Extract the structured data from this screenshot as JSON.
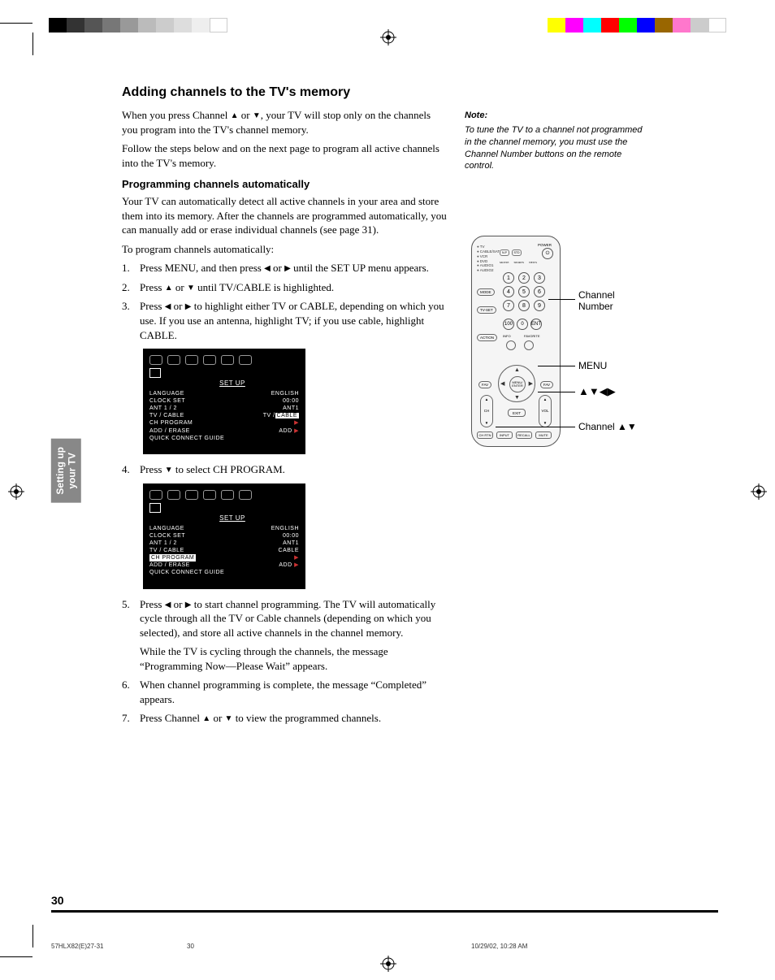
{
  "colorBar": [
    "#000",
    "#333",
    "#555",
    "#777",
    "#999",
    "#bbb",
    "#ccc",
    "#ddd",
    "#eee",
    "#fff"
  ],
  "colorBarR": [
    "#ff0",
    "#f0f",
    "#0ff",
    "#f00",
    "#0f0",
    "#00f",
    "#960",
    "#f7c",
    "#ccc",
    "#fff"
  ],
  "title": "Adding channels to the TV's memory",
  "intro1_a": "When you press Channel ",
  "intro1_b": " or ",
  "intro1_c": ", your TV will stop only on the channels you program into the TV's channel memory.",
  "intro2": "Follow the steps below and on the next page to program all active channels into the TV's memory.",
  "subhead": "Programming channels automatically",
  "para1": "Your TV can automatically detect all active channels in your area and store them into its memory. After the channels are programmed automatically, you can manually add or erase individual channels (see page 31).",
  "para2": "To program channels automatically:",
  "step1_a": "Press MENU, and then press ",
  "step1_b": " or ",
  "step1_c": " until the SET UP menu appears.",
  "step2_a": "Press ",
  "step2_b": " or ",
  "step2_c": " until TV/CABLE is highlighted.",
  "step3_a": "Press ",
  "step3_b": " or ",
  "step3_c": " to highlight either TV or CABLE, depending on which you use. If you use an antenna, highlight TV; if you use cable, highlight CABLE.",
  "step4_a": "Press ",
  "step4_b": " to select CH PROGRAM.",
  "step5_a": "Press ",
  "step5_b": " or ",
  "step5_c": " to start channel programming. The TV will automatically cycle through all the TV or Cable channels (depending on which you selected), and store all active channels in the channel memory.",
  "step5_note": "While the TV is cycling through the channels, the message “Programming Now—Please Wait” appears.",
  "step6": "When channel programming is complete, the message “Completed” appears.",
  "step7_a": "Press Channel ",
  "step7_b": " or ",
  "step7_c": " to view the programmed channels.",
  "osd": {
    "title": "SET  UP",
    "rows1": [
      {
        "l": "LANGUAGE",
        "r": "ENGLISH"
      },
      {
        "l": "CLOCK  SET",
        "r": "00:00"
      },
      {
        "l": "ANT 1 / 2",
        "r": "ANT1"
      }
    ],
    "tvcable_l": "TV / CABLE",
    "tvcable_tv": "TV /",
    "tvcable_hl": "CABLE",
    "rows1b": [
      {
        "l": "CH  PROGRAM",
        "r": ""
      },
      {
        "l": "ADD / ERASE",
        "r": "ADD"
      },
      {
        "l": "QUICK CONNECT GUIDE",
        "r": ""
      }
    ],
    "rows2": [
      {
        "l": "LANGUAGE",
        "r": "ENGLISH"
      },
      {
        "l": "CLOCK  SET",
        "r": "00:00"
      },
      {
        "l": "ANT 1 / 2",
        "r": "ANT1"
      },
      {
        "l": "TV / CABLE",
        "r": "CABLE"
      }
    ],
    "chprog_l": "CH  PROGRAM",
    "rows2b": [
      {
        "l": "ADD / ERASE",
        "r": "ADD"
      },
      {
        "l": "QUICK CONNECT GUIDE",
        "r": ""
      }
    ]
  },
  "note_head": "Note:",
  "note_body": "To tune the TV to a channel not programmed in the channel memory, you must use the Channel Number buttons on the remote control.",
  "remote": {
    "devices": [
      "TV",
      "CABLE/SAT",
      "VCR",
      "DVD",
      "AUDIO1",
      "AUDIO2"
    ],
    "power": "POWER",
    "topbtns": [
      "N-P",
      "STD",
      ""
    ],
    "labels_row": [
      "MOVIE",
      "SPORTS",
      "NEWS"
    ],
    "numbers": [
      "1",
      "2",
      "3",
      "4",
      "5",
      "6",
      "7",
      "8",
      "9"
    ],
    "bottom_nums": [
      "100",
      "0",
      "ENT"
    ],
    "mode": "MODE",
    "tvset": "TV-SET",
    "action": "ACTION",
    "info": "INFO",
    "favorite": "FAVORITE",
    "menu_enter": "MENU/\nENTER",
    "fav": "FAV",
    "ch": "CH",
    "vol": "VOL",
    "exit": "EXIT",
    "bottom": [
      "CH RTN",
      "INPUT",
      "RECALL",
      "MUTE"
    ]
  },
  "callouts": {
    "chnum": "Channel\nNumber",
    "menu": "MENU",
    "arrows": "▲▼◀▶",
    "chupdown": "Channel ▲▼"
  },
  "sidebar": "Setting up\nyour TV",
  "pageNum": "30",
  "footer_l": "57HLX82(E)27-31",
  "footer_c": "30",
  "footer_r": "10/29/02, 10:28 AM"
}
